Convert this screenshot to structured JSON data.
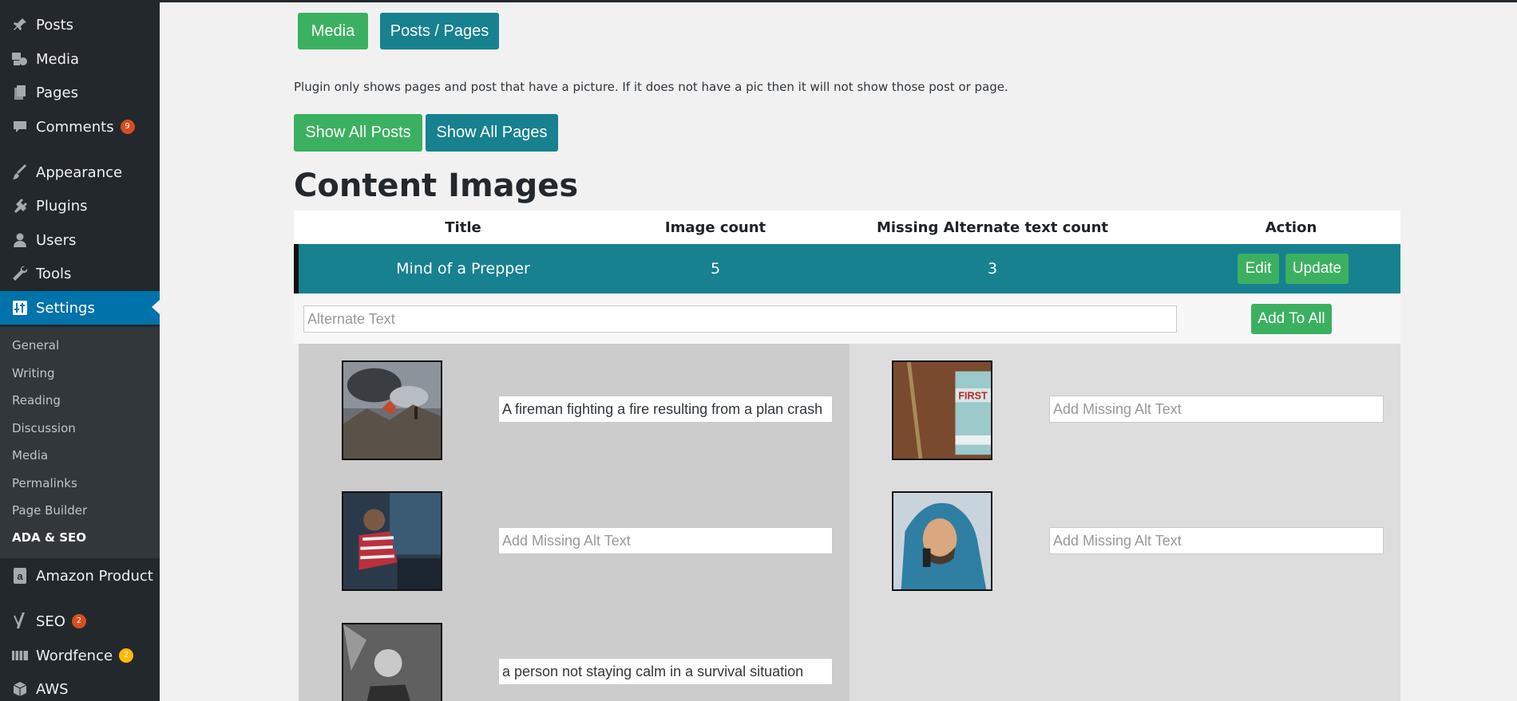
{
  "sidebar": {
    "items": [
      {
        "label": "Posts",
        "icon": "pin-icon"
      },
      {
        "label": "Media",
        "icon": "media-icon"
      },
      {
        "label": "Pages",
        "icon": "pages-icon"
      },
      {
        "label": "Comments",
        "icon": "comment-icon",
        "badge": "9"
      },
      {
        "label": "Appearance",
        "icon": "paintbrush-icon"
      },
      {
        "label": "Plugins",
        "icon": "plugin-icon"
      },
      {
        "label": "Users",
        "icon": "user-icon"
      },
      {
        "label": "Tools",
        "icon": "wrench-icon"
      },
      {
        "label": "Settings",
        "icon": "settings-icon"
      },
      {
        "label": "Amazon Product",
        "icon": "amazon-icon"
      },
      {
        "label": "SEO",
        "icon": "yoast-icon",
        "badge": "2"
      },
      {
        "label": "Wordfence",
        "icon": "wordfence-icon",
        "badge": "2"
      },
      {
        "label": "AWS",
        "icon": "cube-icon"
      }
    ],
    "submenu": [
      "General",
      "Writing",
      "Reading",
      "Discussion",
      "Media",
      "Permalinks",
      "Page Builder",
      "ADA & SEO"
    ]
  },
  "tabs": {
    "media": "Media",
    "posts_pages": "Posts / Pages"
  },
  "notice": "Plugin only shows pages and post that have a picture. If it does not have a pic then it will not show those post or page.",
  "buttons": {
    "show_all_posts": "Show All Posts",
    "show_all_pages": "Show All Pages"
  },
  "heading": "Content Images",
  "table": {
    "columns": [
      "Title",
      "Image count",
      "Missing Alternate text count",
      "Action"
    ],
    "row": {
      "title": "Mind of a Prepper",
      "image_count": "5",
      "missing_count": "3",
      "edit": "Edit",
      "update": "Update"
    }
  },
  "alt_text": {
    "placeholder": "Alternate Text",
    "add_to_all": "Add To All"
  },
  "images": [
    {
      "alt": "A fireman fighting a fire resulting from a plan crash",
      "placeholder": "Add Missing Alt Text"
    },
    {
      "alt": "",
      "placeholder": "Add Missing Alt Text"
    },
    {
      "alt": "",
      "placeholder": "Add Missing Alt Text"
    },
    {
      "alt": "",
      "placeholder": "Add Missing Alt Text"
    },
    {
      "alt": "a person not staying calm in a survival situation",
      "placeholder": "Add Missing Alt Text"
    }
  ],
  "colors": {
    "sidebar": "#23282d",
    "active": "#0073aa",
    "green": "#3cb061",
    "teal": "#17818f",
    "badge": "#d54e21"
  }
}
